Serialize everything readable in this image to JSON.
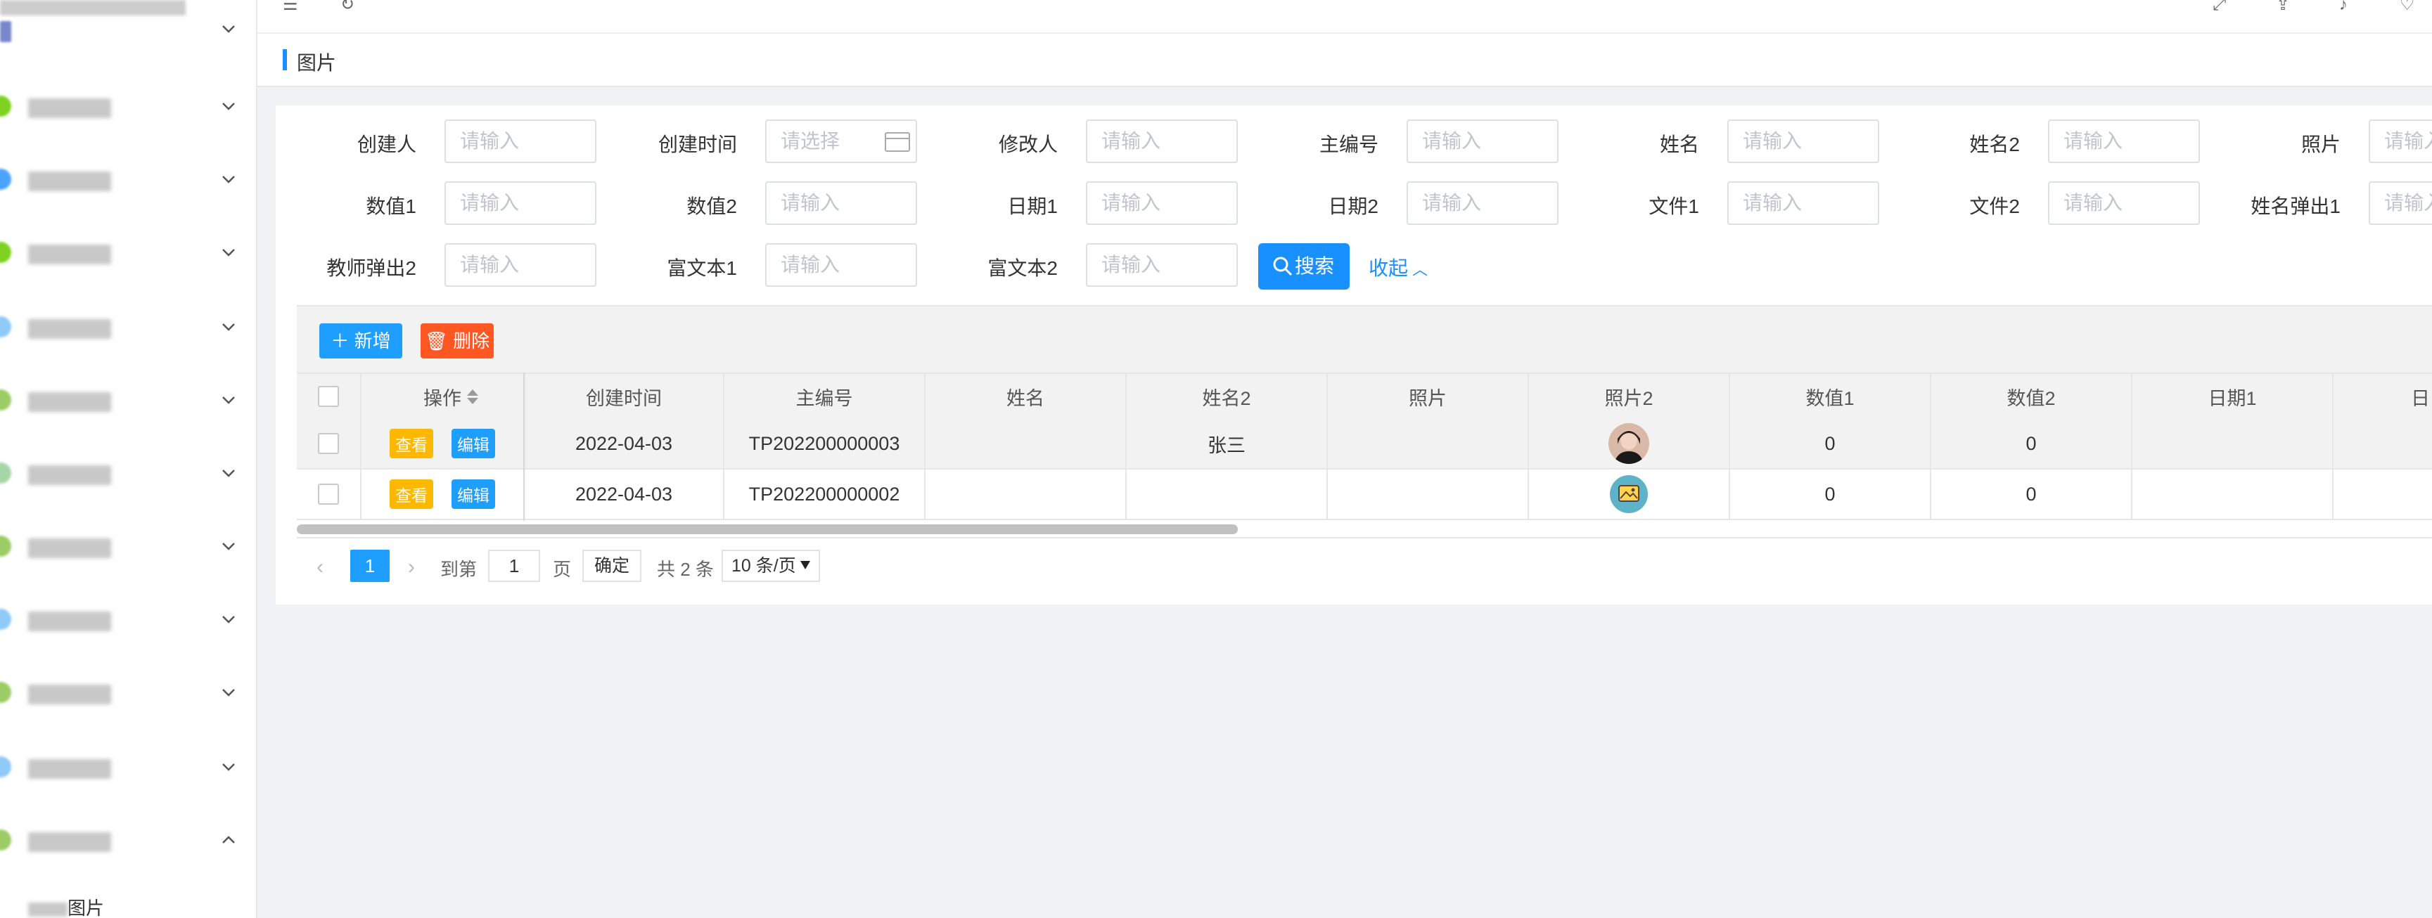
{
  "breadcrumb": {
    "current": "图片"
  },
  "sidebar": {
    "items": [
      {
        "icon_color": "#7986cb"
      },
      {
        "icon_color": "#7ed321"
      },
      {
        "icon_color": "#4aa3ff"
      },
      {
        "icon_color": "#7ed321"
      },
      {
        "icon_color": "#90caf9"
      },
      {
        "icon_color": "#9ccc65"
      },
      {
        "icon_color": "#a5d6a7"
      },
      {
        "icon_color": "#9ccc65"
      },
      {
        "icon_color": "#90caf9"
      },
      {
        "icon_color": "#9ccc65"
      },
      {
        "icon_color": "#90caf9"
      },
      {
        "icon_color": "#9ccc65"
      }
    ],
    "active_sub_label": "图片"
  },
  "search": {
    "fields": [
      {
        "label": "创建人",
        "placeholder": "请输入"
      },
      {
        "label": "创建时间",
        "placeholder": "请选择",
        "type": "date"
      },
      {
        "label": "修改人",
        "placeholder": "请输入"
      },
      {
        "label": "主编号",
        "placeholder": "请输入"
      },
      {
        "label": "姓名",
        "placeholder": "请输入"
      },
      {
        "label": "姓名2",
        "placeholder": "请输入"
      },
      {
        "label": "照片",
        "placeholder": "请输入"
      },
      {
        "label": "数值1",
        "placeholder": "请输入"
      },
      {
        "label": "数值2",
        "placeholder": "请输入"
      },
      {
        "label": "日期1",
        "placeholder": "请输入"
      },
      {
        "label": "日期2",
        "placeholder": "请输入"
      },
      {
        "label": "文件1",
        "placeholder": "请输入"
      },
      {
        "label": "文件2",
        "placeholder": "请输入"
      },
      {
        "label": "姓名弹出1",
        "placeholder": "请输入"
      },
      {
        "label": "教师弹出2",
        "placeholder": "请输入"
      },
      {
        "label": "富文本1",
        "placeholder": "请输入"
      },
      {
        "label": "富文本2",
        "placeholder": "请输入"
      }
    ],
    "search_button": "搜索",
    "collapse_link": "收起"
  },
  "toolbar": {
    "add": "新增",
    "delete": "删除"
  },
  "table": {
    "columns": [
      "操作",
      "创建时间",
      "主编号",
      "姓名",
      "姓名2",
      "照片",
      "照片2",
      "数值1",
      "数值2",
      "日期1",
      "日"
    ],
    "action_view": "查看",
    "action_edit": "编辑",
    "rows": [
      {
        "created": "2022-04-03",
        "code": "TP202200000003",
        "name": "",
        "name2": "张三",
        "photo": "",
        "photo2": "avatar",
        "num1": "0",
        "num2": "0",
        "date1": ""
      },
      {
        "created": "2022-04-03",
        "code": "TP202200000002",
        "name": "",
        "name2": "",
        "photo": "",
        "photo2": "image-placeholder",
        "num1": "0",
        "num2": "0",
        "date1": ""
      }
    ]
  },
  "pagination": {
    "current_page": "1",
    "goto_label": "到第",
    "goto_value": "1",
    "page_unit": "页",
    "confirm": "确定",
    "total": "共 2 条",
    "page_size": "10 条/页"
  },
  "colors": {
    "primary": "#1890ff",
    "add": "#1e9fff",
    "delete": "#ff5722",
    "view": "#ffb800"
  }
}
